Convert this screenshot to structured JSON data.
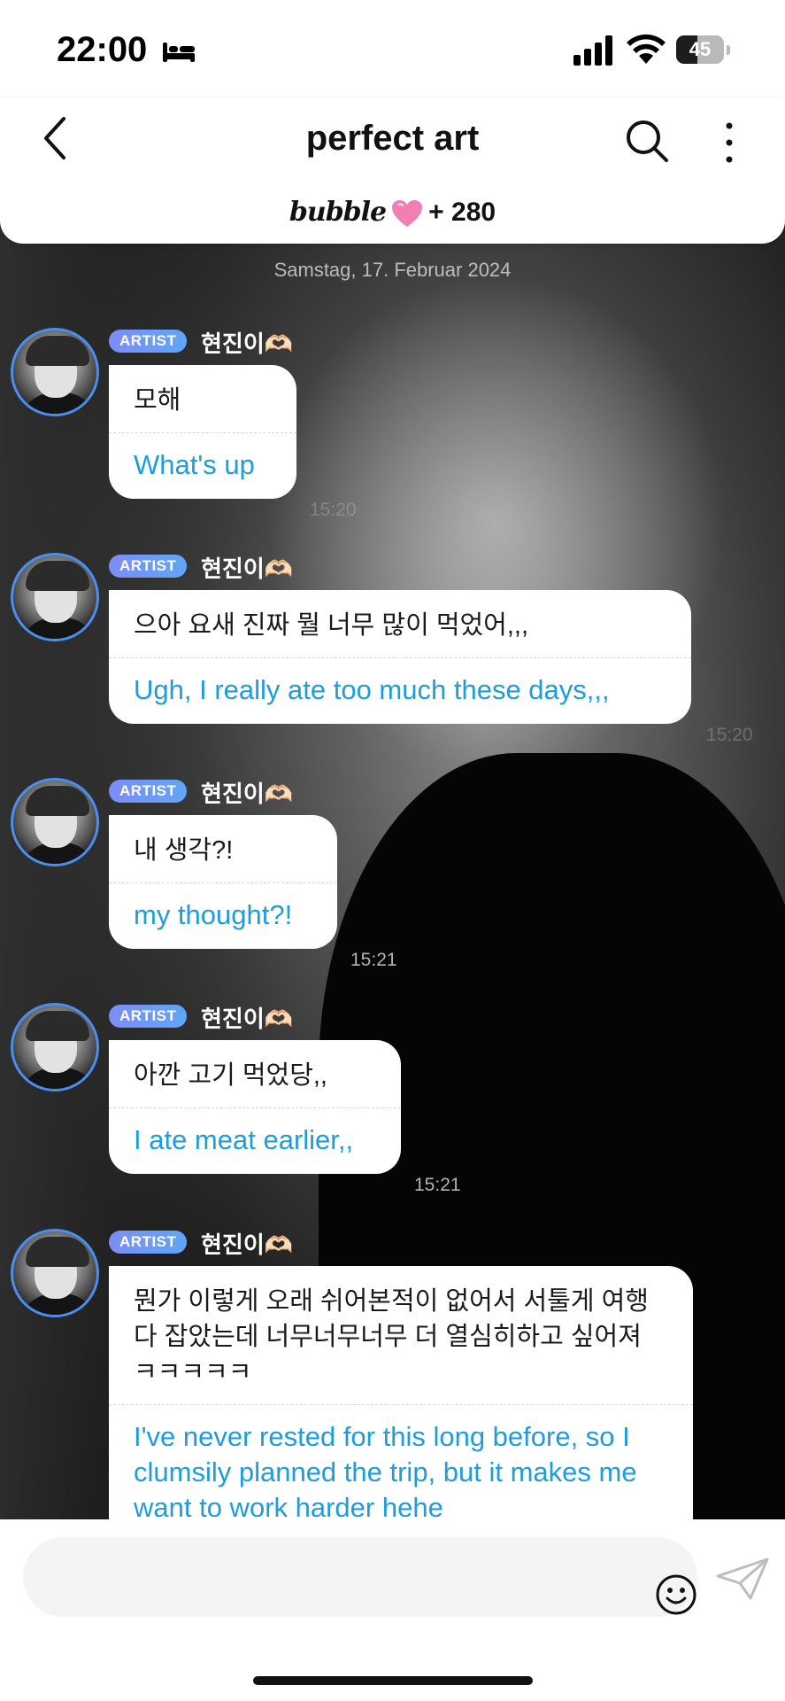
{
  "status_bar": {
    "time": "22:00",
    "battery": "45",
    "battery_level": 0.45
  },
  "header": {
    "title": "perfect art",
    "brand": "bubble",
    "subscriber_count": "+ 280"
  },
  "chat": {
    "date": "Samstag, 17. Februar 2024",
    "messages": [
      {
        "badge": "ARTIST",
        "sender": "현진이🫶🏻",
        "korean": "모해",
        "translation": "What's up",
        "time": "15:20"
      },
      {
        "badge": "ARTIST",
        "sender": "현진이🫶🏻",
        "korean": "으아 요새 진짜 뭘 너무 많이 먹었어,,,",
        "translation": "Ugh, I really ate too much these days,,,",
        "time": "15:20"
      },
      {
        "badge": "ARTIST",
        "sender": "현진이🫶🏻",
        "korean": "내 생각?!",
        "translation": "my thought?!",
        "time": "15:21"
      },
      {
        "badge": "ARTIST",
        "sender": "현진이🫶🏻",
        "korean": "아깐 고기 먹었당,,",
        "translation": "I ate meat earlier,,",
        "time": "15:21"
      },
      {
        "badge": "ARTIST",
        "sender": "현진이🫶🏻",
        "korean": "뭔가 이렇게 오래 쉬어본적이 없어서 서툴게 여행 다 잡았는데 너무너무너무 더 열심히하고 싶어져 ㅋㅋㅋㅋㅋ",
        "translation": "I've never rested for this long before, so I clumsily planned the trip, but it makes me want to work harder hehe",
        "time": ""
      }
    ]
  },
  "input": {
    "placeholder": ""
  },
  "icons": {
    "back": "chevron-left-icon",
    "search": "search-icon",
    "more": "more-vertical-icon",
    "emoji": "smiley-icon",
    "send": "send-icon",
    "heart": "heart-icon"
  },
  "colors": {
    "accent_blue": "#1e9cdc",
    "badge_gradient_start": "#7d8df5",
    "badge_gradient_end": "#5fa6f7",
    "heart_pink": "#f27fb3"
  }
}
